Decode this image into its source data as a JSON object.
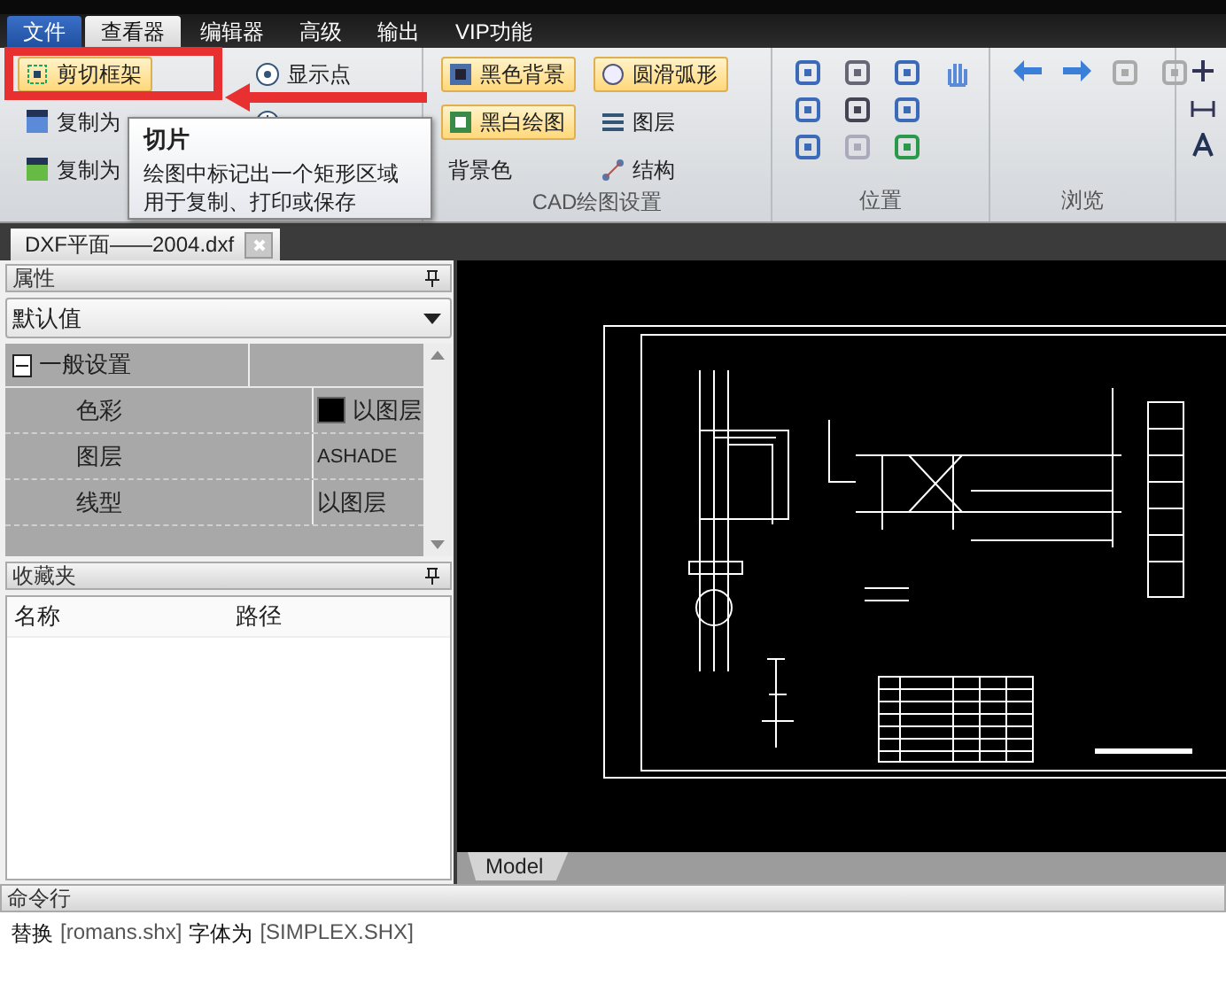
{
  "menu_tabs": [
    {
      "label": "文件",
      "kind": "file",
      "selected": false
    },
    {
      "label": "查看器",
      "kind": "tab",
      "selected": true
    },
    {
      "label": "编辑器",
      "kind": "tab",
      "selected": false
    },
    {
      "label": "高级",
      "kind": "tab",
      "selected": false
    },
    {
      "label": "输出",
      "kind": "tab",
      "selected": false
    },
    {
      "label": "VIP功能",
      "kind": "tab",
      "selected": false
    }
  ],
  "ribbon": {
    "groups": [
      {
        "kind": "buttons",
        "columns": [
          [
            {
              "label": "剪切框架",
              "active": true
            },
            {
              "label": "复制为",
              "active": false
            },
            {
              "label": "复制为",
              "active": false
            }
          ],
          [
            {
              "label": "显示点",
              "active": false
            },
            {
              "active": false
            }
          ]
        ]
      },
      {
        "kind": "buttons",
        "label": "CAD绘图设置",
        "columns": [
          [
            {
              "label": "黑色背景",
              "active": true
            },
            {
              "label": "黑白绘图",
              "active": true
            },
            {
              "label": "背景色",
              "active": false
            }
          ],
          [
            {
              "label": "圆滑弧形",
              "active": true
            },
            {
              "label": "图层",
              "active": false
            },
            {
              "label": "结构",
              "active": false
            }
          ]
        ]
      },
      {
        "kind": "position",
        "label": "位置"
      },
      {
        "kind": "browse",
        "label": "浏览"
      },
      {
        "kind": "tools"
      }
    ]
  },
  "tooltip": {
    "title": "切片",
    "lines": [
      "绘图中标记出一个矩形区域",
      "用于复制、打印或保存"
    ]
  },
  "document_tab": {
    "label": "DXF平面——2004.dxf"
  },
  "properties": {
    "title": "属性",
    "preset": "默认值",
    "category": {
      "label": "一般设置",
      "expanded": true
    },
    "rows": [
      {
        "name": "色彩",
        "value": "以图层",
        "kind": "color"
      },
      {
        "name": "图层",
        "value": "ASHADE",
        "kind": "latin"
      },
      {
        "name": "线型",
        "value": "以图层",
        "kind": "text"
      }
    ]
  },
  "favorites": {
    "title": "收藏夹",
    "columns": [
      "名称",
      "路径"
    ]
  },
  "layout_tabs": [
    {
      "label": "Model",
      "selected": true
    }
  ],
  "command_line": {
    "title": "命令行",
    "output": [
      {
        "text": "替换",
        "kind": "plain"
      },
      {
        "text": "[romans.shx]",
        "kind": "arg"
      },
      {
        "text": "字体为",
        "kind": "plain"
      },
      {
        "text": "[SIMPLEX.SHX]",
        "kind": "arg"
      }
    ]
  }
}
